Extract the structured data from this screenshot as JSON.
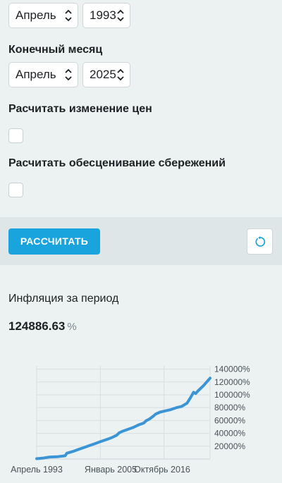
{
  "start": {
    "month": "Апрель",
    "year": "1993"
  },
  "end_label": "Конечный месяц",
  "end": {
    "month": "Апрель",
    "year": "2025"
  },
  "price_change_label": "Расчитать изменение цен",
  "price_change_checked": false,
  "savings_label": "Расчитать обесценивание сбережений",
  "savings_checked": false,
  "calculate_label": "РАССЧИТАТЬ",
  "reset_icon": "refresh-icon",
  "result": {
    "label": "Инфляция за период",
    "value": "124886.63",
    "unit": "%"
  },
  "colors": {
    "accent": "#1aa4de",
    "line": "#3a94d6",
    "background": "#ecf1f2",
    "bar": "#dfe6e8"
  },
  "chart_data": {
    "type": "line",
    "title": "",
    "xlabel": "",
    "ylabel": "",
    "x_tick_labels": [
      "Апрель 1993",
      "Январь 2005",
      "Октябрь 2016"
    ],
    "y_tick_labels": [
      "20000%",
      "40000%",
      "60000%",
      "80000%",
      "100000%",
      "120000%",
      "140000%"
    ],
    "y_ticks": [
      20000,
      40000,
      60000,
      80000,
      100000,
      120000,
      140000
    ],
    "ylim": [
      0,
      145000
    ],
    "xlim": [
      1993.25,
      2025.25
    ],
    "x_ticks": [
      1993.25,
      2005.0,
      2016.75
    ],
    "grid": true,
    "series": [
      {
        "x": [
          1993.25,
          1994.5,
          1995.5,
          1997.0,
          1998.5,
          1998.8,
          2000.0,
          2001.0,
          2002.0,
          2003.0,
          2004.0,
          2005.0,
          2006.0,
          2007.0,
          2008.0,
          2008.5,
          2009.0,
          2010.0,
          2011.0,
          2012.0,
          2013.0,
          2013.5,
          2014.0,
          2014.8,
          2015.2,
          2016.0,
          2017.0,
          2018.0,
          2019.0,
          2020.0,
          2021.0,
          2021.6,
          2022.2,
          2022.6,
          2023.0,
          2024.0,
          2025.25
        ],
        "values": [
          500,
          1500,
          3000,
          3500,
          5000,
          9000,
          12000,
          15000,
          18000,
          21000,
          24000,
          27000,
          30000,
          33000,
          37000,
          41000,
          43000,
          46000,
          49000,
          53000,
          56000,
          60000,
          62000,
          67000,
          70000,
          73000,
          75000,
          77000,
          80000,
          82000,
          87000,
          95000,
          104000,
          102000,
          106000,
          114000,
          126000
        ]
      }
    ]
  }
}
